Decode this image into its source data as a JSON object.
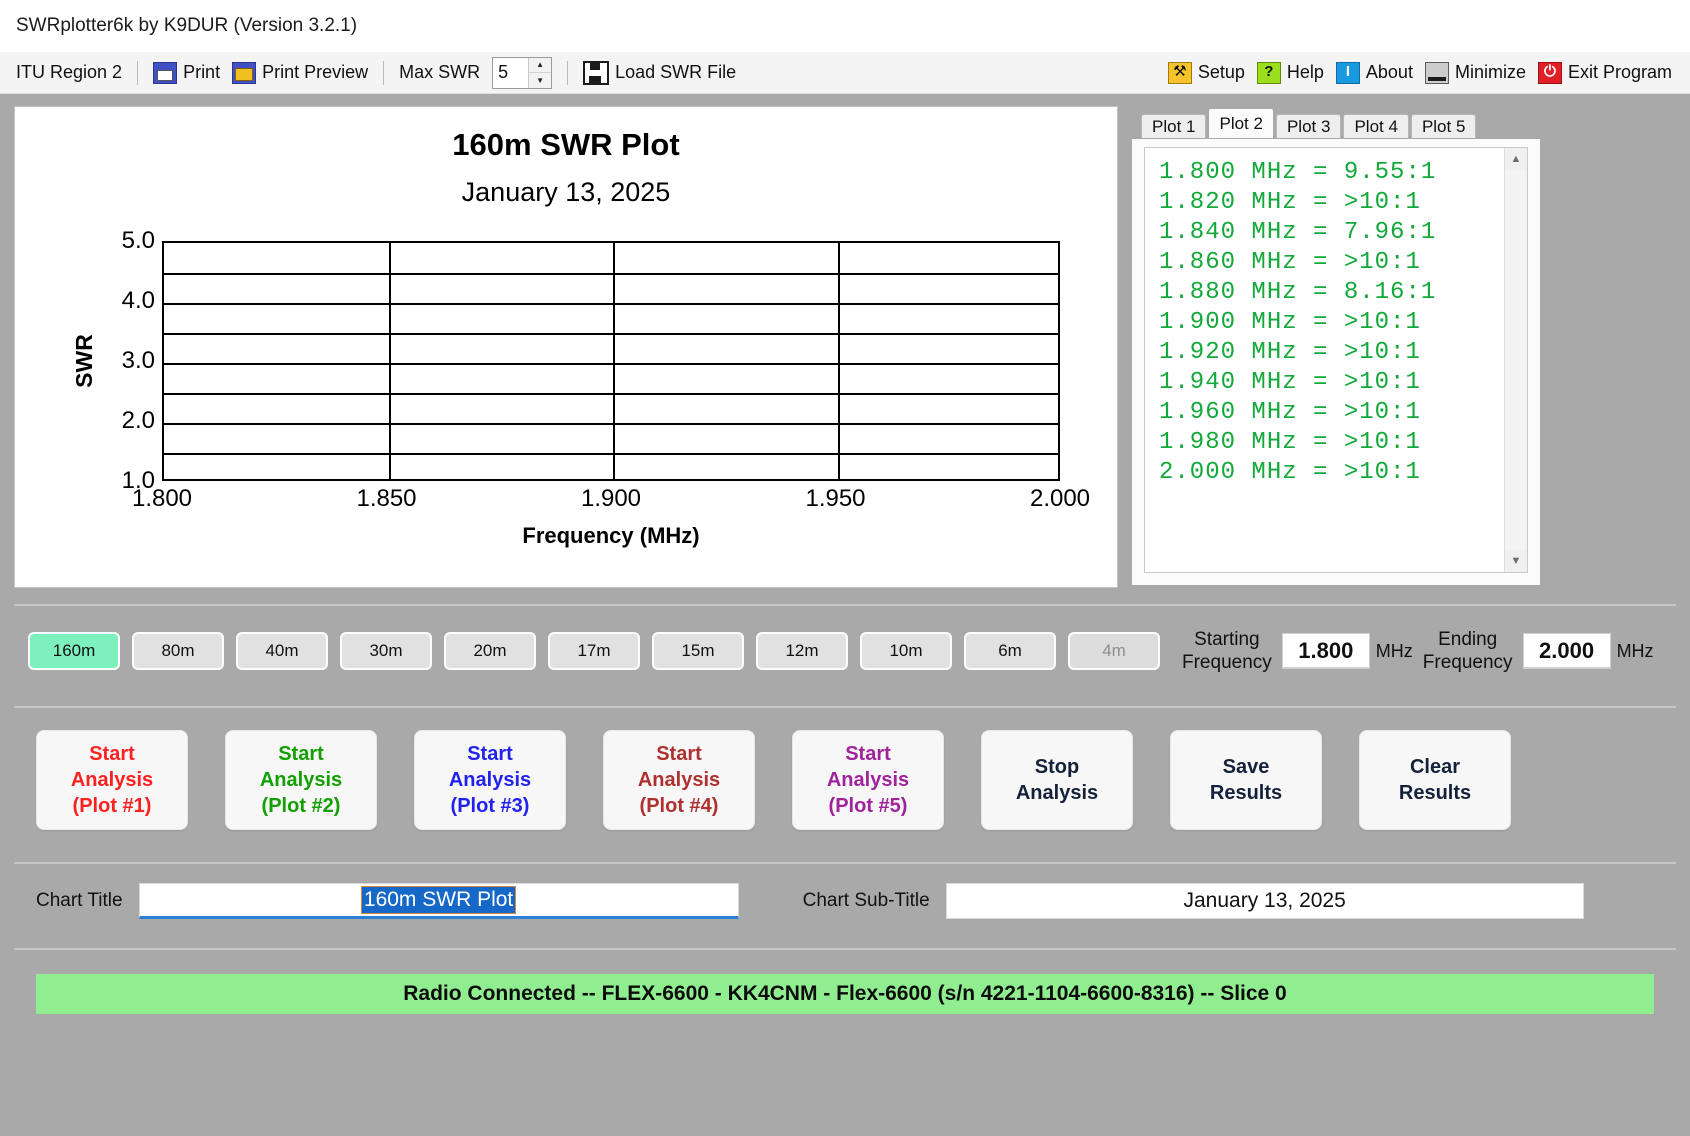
{
  "window": {
    "title": "SWRplotter6k by K9DUR (Version 3.2.1)"
  },
  "toolbar": {
    "itu_region": "ITU Region 2",
    "print": "Print",
    "print_preview": "Print Preview",
    "max_swr_label": "Max SWR",
    "max_swr_value": "5",
    "load_swr_file": "Load SWR File",
    "setup": "Setup",
    "help": "Help",
    "about": "About",
    "minimize": "Minimize",
    "exit": "Exit Program",
    "icons": {
      "print": "printer-icon",
      "print_preview": "print-preview-icon",
      "load": "floppy-save-icon",
      "setup": "tools-icon",
      "help": "question-mark-icon",
      "about": "info-icon",
      "minimize": "minimize-icon",
      "exit": "power-icon"
    },
    "spin_up": "▲",
    "spin_down": "▼"
  },
  "chart_data": {
    "type": "line",
    "title": "160m SWR Plot",
    "subtitle": "January 13, 2025",
    "xlabel": "Frequency (MHz)",
    "ylabel": "SWR",
    "xlim": [
      1.8,
      2.0
    ],
    "ylim": [
      1.0,
      5.0
    ],
    "grid": true,
    "x_ticks": [
      "1.800",
      "1.850",
      "1.900",
      "1.950",
      "2.000"
    ],
    "x_tick_values": [
      1.8,
      1.85,
      1.9,
      1.95,
      2.0
    ],
    "y_ticks": [
      "1.0",
      "2.0",
      "3.0",
      "4.0",
      "5.0"
    ],
    "y_tick_values": [
      1.0,
      2.0,
      3.0,
      4.0,
      5.0
    ],
    "y_gridlines": [
      1.0,
      1.5,
      2.0,
      2.5,
      3.0,
      3.5,
      4.0,
      4.5,
      5.0
    ],
    "x_gridlines": [
      1.8,
      1.85,
      1.9,
      1.95,
      2.0
    ],
    "series": [
      {
        "name": "Plot 2",
        "x": [],
        "values": []
      }
    ],
    "note": "plot area empty - no trace drawn"
  },
  "results": {
    "tabs": [
      {
        "label": "Plot 1",
        "active": false
      },
      {
        "label": "Plot 2",
        "active": true
      },
      {
        "label": "Plot 3",
        "active": false
      },
      {
        "label": "Plot 4",
        "active": false
      },
      {
        "label": "Plot 5",
        "active": false
      }
    ],
    "text_color": "#12a93a",
    "lines": [
      "1.800 MHz = 9.55:1",
      "1.820 MHz = >10:1",
      "1.840 MHz = 7.96:1",
      "1.860 MHz = >10:1",
      "1.880 MHz = 8.16:1",
      "1.900 MHz = >10:1",
      "1.920 MHz = >10:1",
      "1.940 MHz = >10:1",
      "1.960 MHz = >10:1",
      "1.980 MHz = >10:1",
      "2.000 MHz = >10:1"
    ],
    "scroll_up": "▲",
    "scroll_down": "▼"
  },
  "bands": [
    {
      "label": "160m",
      "selected": true,
      "disabled": false
    },
    {
      "label": "80m",
      "selected": false,
      "disabled": false
    },
    {
      "label": "40m",
      "selected": false,
      "disabled": false
    },
    {
      "label": "30m",
      "selected": false,
      "disabled": false
    },
    {
      "label": "20m",
      "selected": false,
      "disabled": false
    },
    {
      "label": "17m",
      "selected": false,
      "disabled": false
    },
    {
      "label": "15m",
      "selected": false,
      "disabled": false
    },
    {
      "label": "12m",
      "selected": false,
      "disabled": false
    },
    {
      "label": "10m",
      "selected": false,
      "disabled": false
    },
    {
      "label": "6m",
      "selected": false,
      "disabled": false
    },
    {
      "label": "4m",
      "selected": false,
      "disabled": true
    }
  ],
  "frequency": {
    "start_label_line1": "Starting",
    "start_label_line2": "Frequency",
    "start_value": "1.800",
    "start_unit": "MHz",
    "end_label_line1": "Ending",
    "end_label_line2": "Frequency",
    "end_value": "2.000",
    "end_unit": "MHz"
  },
  "actions": [
    {
      "line1": "Start",
      "line2": "Analysis",
      "line3": "(Plot #1)",
      "color": "#ff2020"
    },
    {
      "line1": "Start",
      "line2": "Analysis",
      "line3": "(Plot #2)",
      "color": "#12a000"
    },
    {
      "line1": "Start",
      "line2": "Analysis",
      "line3": "(Plot #3)",
      "color": "#2222ee"
    },
    {
      "line1": "Start",
      "line2": "Analysis",
      "line3": "(Plot #4)",
      "color": "#b03030"
    },
    {
      "line1": "Start",
      "line2": "Analysis",
      "line3": "(Plot #5)",
      "color": "#a0239c"
    },
    {
      "line1": "Stop",
      "line2": "Analysis",
      "line3": "",
      "color": "#14213a"
    },
    {
      "line1": "Save",
      "line2": "Results",
      "line3": "",
      "color": "#14213a"
    },
    {
      "line1": "Clear",
      "line2": "Results",
      "line3": "",
      "color": "#14213a"
    }
  ],
  "chart_fields": {
    "title_label": "Chart Title",
    "title_value": "160m SWR Plot",
    "subtitle_label": "Chart Sub-Title",
    "subtitle_value": "January 13, 2025"
  },
  "status": {
    "message": "Radio Connected -- FLEX-6600 - KK4CNM - Flex-6600  (s/n 4221-1104-6600-8316) -- Slice 0",
    "background": "#90ee90"
  }
}
